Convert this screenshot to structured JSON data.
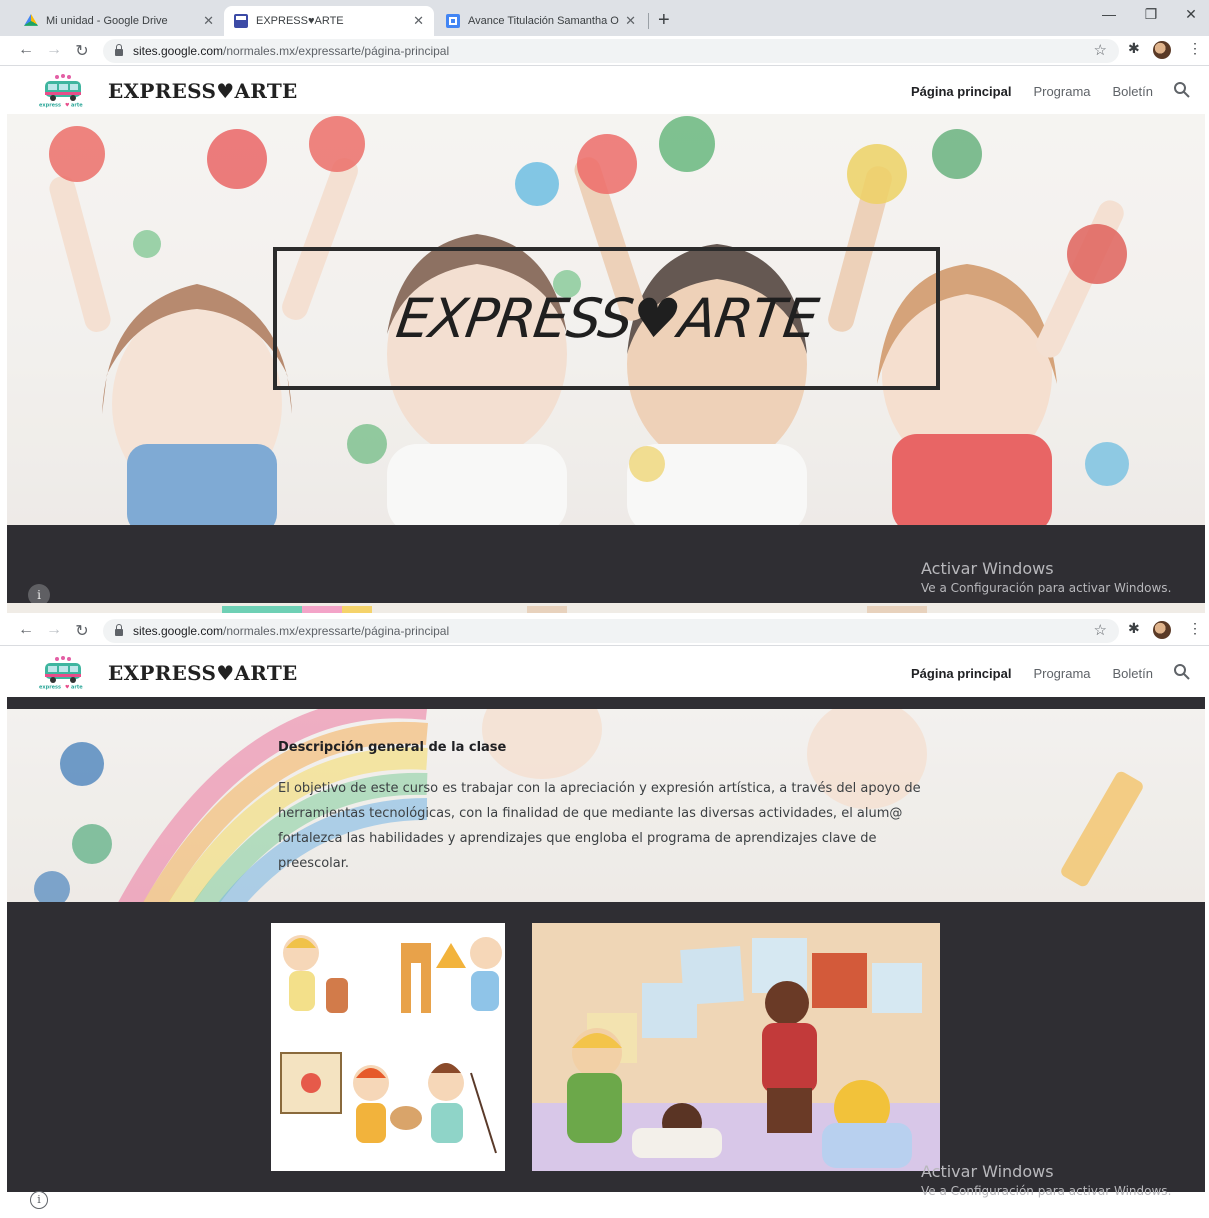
{
  "browser": {
    "tabs": [
      {
        "title": "Mi unidad - Google Drive",
        "active": false,
        "icon": "google-drive-icon"
      },
      {
        "title": "EXPRESS♥ARTE",
        "active": true,
        "icon": "google-sites-icon"
      },
      {
        "title": "Avance Titulación Samantha Ort",
        "active": false,
        "icon": "google-docs-icon"
      }
    ],
    "url_host": "sites.google.com",
    "url_path": "/normales.mx/expressarte/página-principal"
  },
  "site": {
    "title": "EXPRESS♥ARTE",
    "nav": [
      {
        "label": "Página principal",
        "active": true
      },
      {
        "label": "Programa",
        "active": false
      },
      {
        "label": "Boletín",
        "active": false
      }
    ],
    "hero_title": "EXPRESS♥ARTE"
  },
  "description": {
    "title": "Descripción general de la clase",
    "body": "El objetivo de este curso es trabajar con la apreciación y expresión artística, a través del apoyo de herramientas tecnológicas, con la finalidad de que mediante las diversas actividades, el alum@ fortalezca las habilidades y aprendizajes que engloba el programa de aprendizajes clave de preescolar."
  },
  "watermark": {
    "line1": "Activar Windows",
    "line2": "Ve a Configuración para activar Windows."
  },
  "colors": {
    "dark_band": "#2f2e33",
    "tabstrip": "#dee1e6",
    "drive_icon": "#1fa463",
    "sites_icon": "#3c4ba6",
    "docs_icon": "#4285f4"
  }
}
